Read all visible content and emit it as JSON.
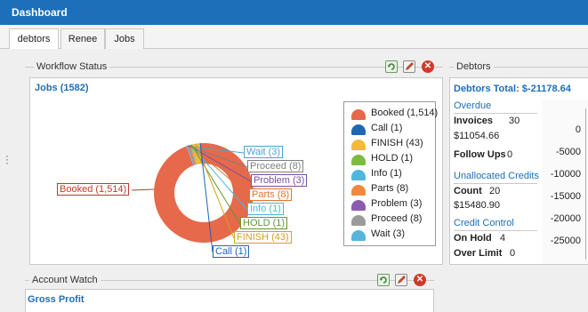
{
  "window": {
    "title": "Dashboard"
  },
  "tabs": [
    {
      "label": "debtors",
      "active": true
    },
    {
      "label": "Renee",
      "active": false
    },
    {
      "label": "Jobs",
      "active": false
    }
  ],
  "workflow": {
    "section_title": "Workflow Status",
    "jobs_heading": "Jobs (1582)",
    "chart_data": {
      "type": "pie",
      "donut": true,
      "categories": [
        "Booked (1,514)",
        "Call (1)",
        "FINISH (43)",
        "HOLD (1)",
        "Info (1)",
        "Parts (8)",
        "Problem (3)",
        "Proceed (8)",
        "Wait (3)"
      ],
      "values": [
        1514,
        1,
        43,
        1,
        1,
        8,
        3,
        8,
        3
      ],
      "colors": [
        "#e5694a",
        "#1f66b5",
        "#f3b93b",
        "#7dbb42",
        "#4fb6dd",
        "#f2883b",
        "#8a5bb0",
        "#9b9b9b",
        "#58b4dc"
      ],
      "legend": "right"
    },
    "callout_labels": [
      {
        "text": "Booked (1,514)",
        "color": "#c0392b"
      },
      {
        "text": "Wait (3)",
        "color": "#4fa2cc"
      },
      {
        "text": "Proceed (8)",
        "color": "#7f7f7f"
      },
      {
        "text": "Problem (3)",
        "color": "#7a4ea3"
      },
      {
        "text": "Parts (8)",
        "color": "#e0762b"
      },
      {
        "text": "Info (1)",
        "color": "#4fb6dd"
      },
      {
        "text": "HOLD (1)",
        "color": "#5e9a2d"
      },
      {
        "text": "FINISH (43)",
        "color": "#d6a020"
      },
      {
        "text": "Call (1)",
        "color": "#1f66b5"
      }
    ]
  },
  "debtors": {
    "section_title": "Debtors",
    "total_heading": "Debtors Total: $-21178.64",
    "overdue_label": "Overdue",
    "invoices_label": "Invoices",
    "invoices_count": "30",
    "invoices_amount": "$11054.66",
    "follow_ups_label": "Follow Ups",
    "follow_ups_count": "0",
    "unallocated_label": "Unallocated Credits",
    "count_label": "Count",
    "count_value": "20",
    "unallocated_amount": "$15480.90",
    "credit_control_label": "Credit Control",
    "on_hold_label": "On Hold",
    "on_hold_value": "4",
    "over_limit_label": "Over Limit",
    "over_limit_value": "0",
    "axis_ticks": [
      "0",
      "-5000",
      "-10000",
      "-15000",
      "-20000",
      "-25000"
    ]
  },
  "account_watch": {
    "section_title": "Account Watch",
    "gross_profit_label": "Gross Profit"
  },
  "icons": {
    "refresh": "refresh-icon",
    "edit": "edit-icon",
    "close": "close-icon",
    "close_glyph": "✕"
  }
}
